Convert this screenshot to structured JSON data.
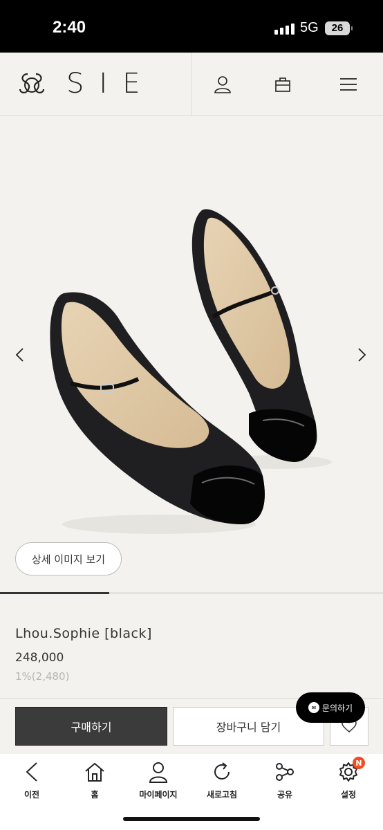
{
  "status_bar": {
    "time": "2:40",
    "network": "5G",
    "battery": "26"
  },
  "header": {
    "brand": "SIE",
    "icons": [
      "user-icon",
      "shopping-bag-icon",
      "menu-icon"
    ]
  },
  "gallery": {
    "detail_button": "상세 이미지 보기",
    "progress": 0.285
  },
  "product": {
    "name": "Lhou.Sophie [black]",
    "price": "248,000",
    "points": "1%(2,480)"
  },
  "actions": {
    "buy": "구매하기",
    "cart": "장바구니 담기",
    "inquiry": "문의하기"
  },
  "bottom_nav": {
    "back": "이전",
    "home": "홈",
    "mypage": "마이페이지",
    "refresh": "새로고침",
    "share": "공유",
    "settings": "설정",
    "settings_badge": "N"
  }
}
